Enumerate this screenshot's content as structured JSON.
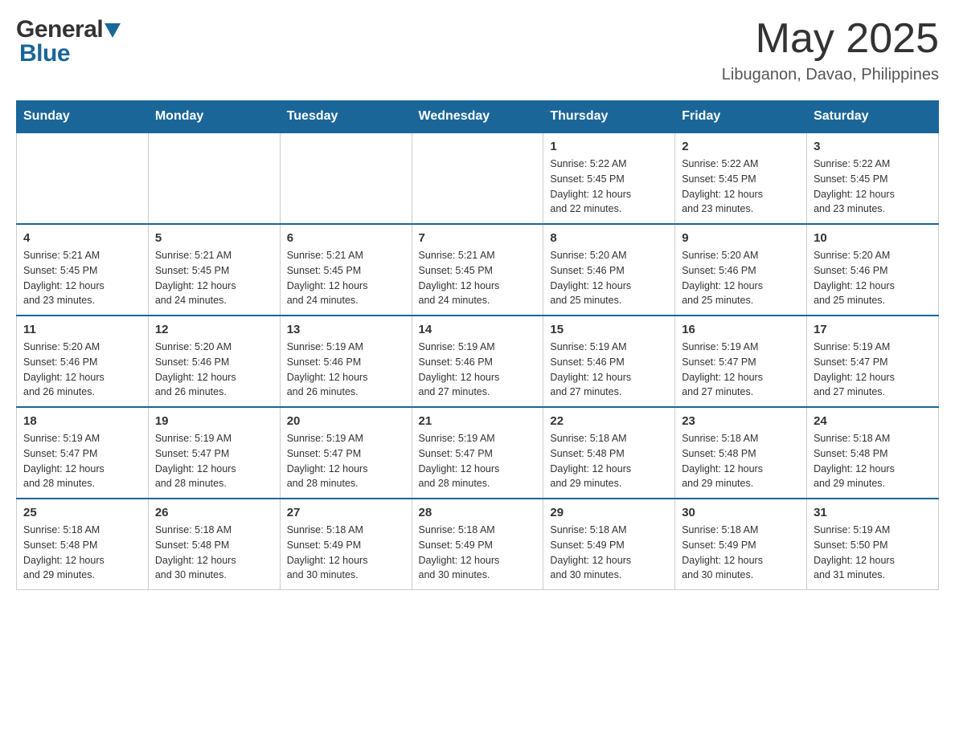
{
  "header": {
    "month_title": "May 2025",
    "location": "Libuganon, Davao, Philippines",
    "logo_general": "General",
    "logo_blue": "Blue"
  },
  "days_of_week": [
    "Sunday",
    "Monday",
    "Tuesday",
    "Wednesday",
    "Thursday",
    "Friday",
    "Saturday"
  ],
  "weeks": [
    {
      "days": [
        {
          "date": "",
          "info": ""
        },
        {
          "date": "",
          "info": ""
        },
        {
          "date": "",
          "info": ""
        },
        {
          "date": "",
          "info": ""
        },
        {
          "date": "1",
          "info": "Sunrise: 5:22 AM\nSunset: 5:45 PM\nDaylight: 12 hours\nand 22 minutes."
        },
        {
          "date": "2",
          "info": "Sunrise: 5:22 AM\nSunset: 5:45 PM\nDaylight: 12 hours\nand 23 minutes."
        },
        {
          "date": "3",
          "info": "Sunrise: 5:22 AM\nSunset: 5:45 PM\nDaylight: 12 hours\nand 23 minutes."
        }
      ]
    },
    {
      "days": [
        {
          "date": "4",
          "info": "Sunrise: 5:21 AM\nSunset: 5:45 PM\nDaylight: 12 hours\nand 23 minutes."
        },
        {
          "date": "5",
          "info": "Sunrise: 5:21 AM\nSunset: 5:45 PM\nDaylight: 12 hours\nand 24 minutes."
        },
        {
          "date": "6",
          "info": "Sunrise: 5:21 AM\nSunset: 5:45 PM\nDaylight: 12 hours\nand 24 minutes."
        },
        {
          "date": "7",
          "info": "Sunrise: 5:21 AM\nSunset: 5:45 PM\nDaylight: 12 hours\nand 24 minutes."
        },
        {
          "date": "8",
          "info": "Sunrise: 5:20 AM\nSunset: 5:46 PM\nDaylight: 12 hours\nand 25 minutes."
        },
        {
          "date": "9",
          "info": "Sunrise: 5:20 AM\nSunset: 5:46 PM\nDaylight: 12 hours\nand 25 minutes."
        },
        {
          "date": "10",
          "info": "Sunrise: 5:20 AM\nSunset: 5:46 PM\nDaylight: 12 hours\nand 25 minutes."
        }
      ]
    },
    {
      "days": [
        {
          "date": "11",
          "info": "Sunrise: 5:20 AM\nSunset: 5:46 PM\nDaylight: 12 hours\nand 26 minutes."
        },
        {
          "date": "12",
          "info": "Sunrise: 5:20 AM\nSunset: 5:46 PM\nDaylight: 12 hours\nand 26 minutes."
        },
        {
          "date": "13",
          "info": "Sunrise: 5:19 AM\nSunset: 5:46 PM\nDaylight: 12 hours\nand 26 minutes."
        },
        {
          "date": "14",
          "info": "Sunrise: 5:19 AM\nSunset: 5:46 PM\nDaylight: 12 hours\nand 27 minutes."
        },
        {
          "date": "15",
          "info": "Sunrise: 5:19 AM\nSunset: 5:46 PM\nDaylight: 12 hours\nand 27 minutes."
        },
        {
          "date": "16",
          "info": "Sunrise: 5:19 AM\nSunset: 5:47 PM\nDaylight: 12 hours\nand 27 minutes."
        },
        {
          "date": "17",
          "info": "Sunrise: 5:19 AM\nSunset: 5:47 PM\nDaylight: 12 hours\nand 27 minutes."
        }
      ]
    },
    {
      "days": [
        {
          "date": "18",
          "info": "Sunrise: 5:19 AM\nSunset: 5:47 PM\nDaylight: 12 hours\nand 28 minutes."
        },
        {
          "date": "19",
          "info": "Sunrise: 5:19 AM\nSunset: 5:47 PM\nDaylight: 12 hours\nand 28 minutes."
        },
        {
          "date": "20",
          "info": "Sunrise: 5:19 AM\nSunset: 5:47 PM\nDaylight: 12 hours\nand 28 minutes."
        },
        {
          "date": "21",
          "info": "Sunrise: 5:19 AM\nSunset: 5:47 PM\nDaylight: 12 hours\nand 28 minutes."
        },
        {
          "date": "22",
          "info": "Sunrise: 5:18 AM\nSunset: 5:48 PM\nDaylight: 12 hours\nand 29 minutes."
        },
        {
          "date": "23",
          "info": "Sunrise: 5:18 AM\nSunset: 5:48 PM\nDaylight: 12 hours\nand 29 minutes."
        },
        {
          "date": "24",
          "info": "Sunrise: 5:18 AM\nSunset: 5:48 PM\nDaylight: 12 hours\nand 29 minutes."
        }
      ]
    },
    {
      "days": [
        {
          "date": "25",
          "info": "Sunrise: 5:18 AM\nSunset: 5:48 PM\nDaylight: 12 hours\nand 29 minutes."
        },
        {
          "date": "26",
          "info": "Sunrise: 5:18 AM\nSunset: 5:48 PM\nDaylight: 12 hours\nand 30 minutes."
        },
        {
          "date": "27",
          "info": "Sunrise: 5:18 AM\nSunset: 5:49 PM\nDaylight: 12 hours\nand 30 minutes."
        },
        {
          "date": "28",
          "info": "Sunrise: 5:18 AM\nSunset: 5:49 PM\nDaylight: 12 hours\nand 30 minutes."
        },
        {
          "date": "29",
          "info": "Sunrise: 5:18 AM\nSunset: 5:49 PM\nDaylight: 12 hours\nand 30 minutes."
        },
        {
          "date": "30",
          "info": "Sunrise: 5:18 AM\nSunset: 5:49 PM\nDaylight: 12 hours\nand 30 minutes."
        },
        {
          "date": "31",
          "info": "Sunrise: 5:19 AM\nSunset: 5:50 PM\nDaylight: 12 hours\nand 31 minutes."
        }
      ]
    }
  ]
}
